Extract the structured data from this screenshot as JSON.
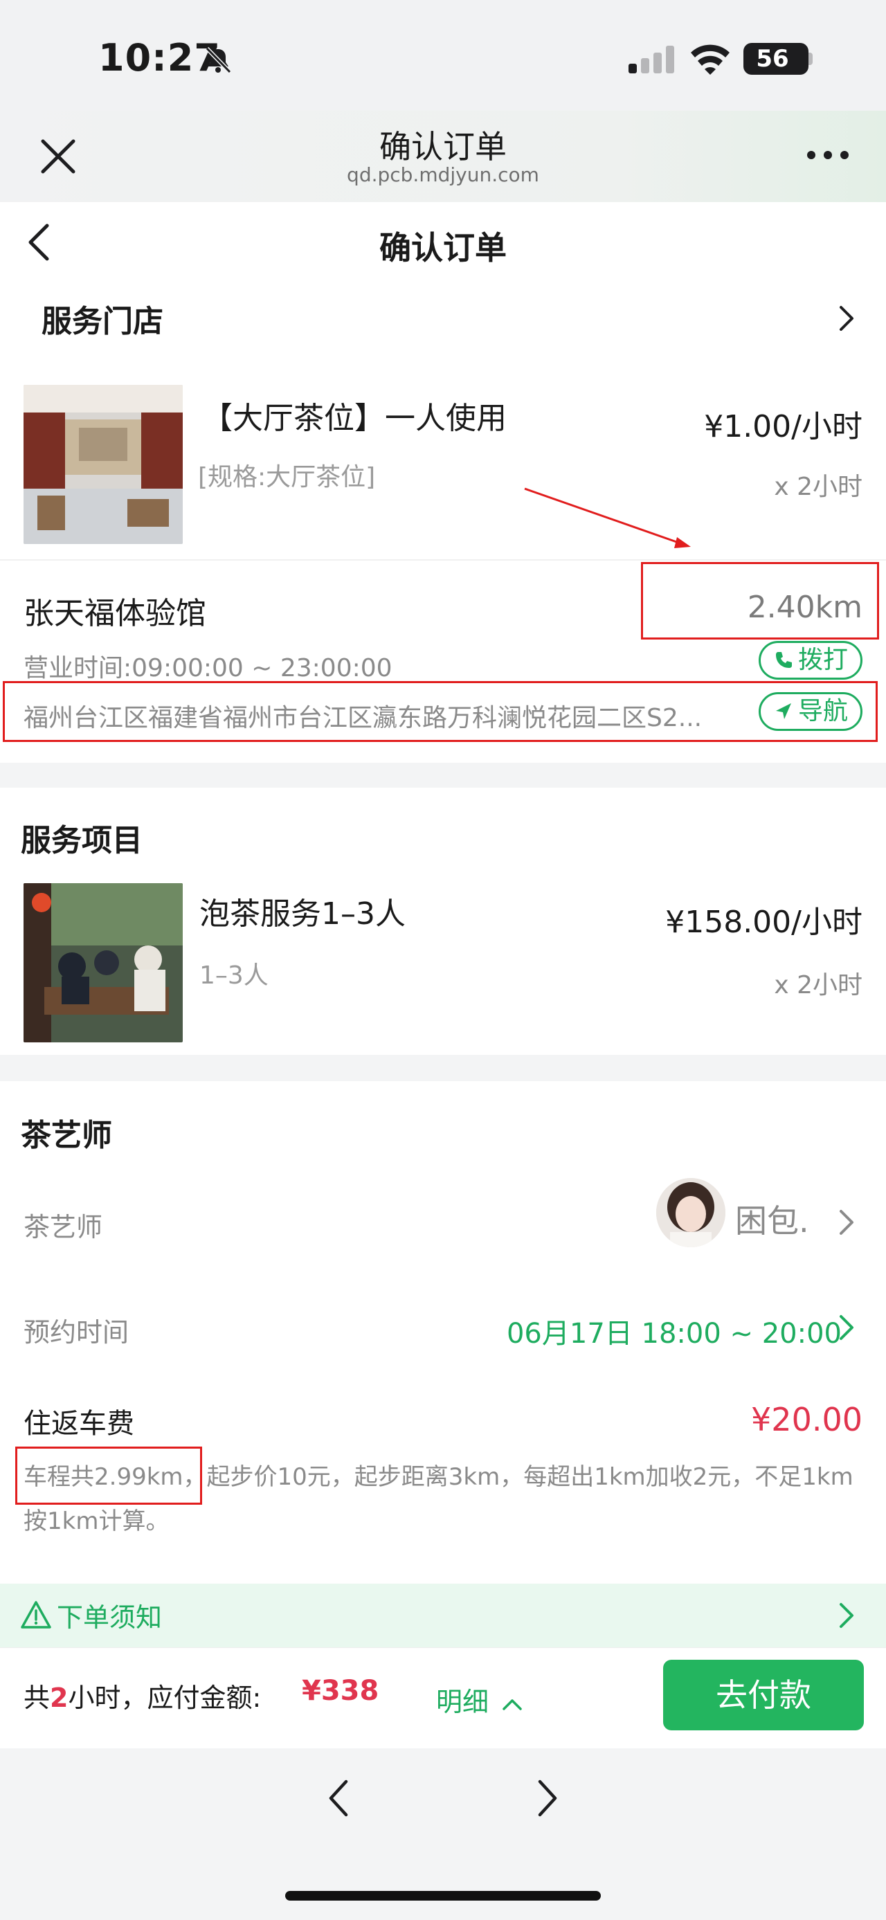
{
  "status_bar": {
    "time": "10:27",
    "battery": "56",
    "icons": [
      "bell-muted-icon",
      "signal-icon",
      "wifi-icon",
      "battery-icon"
    ]
  },
  "browser": {
    "title": "确认订单",
    "url": "qd.pcb.mdjyun.com",
    "icons": [
      "close-icon",
      "more-icon"
    ]
  },
  "header": {
    "title": "确认订单"
  },
  "store_section": {
    "title": "服务门店",
    "product": {
      "name": "【大厅茶位】一人使用",
      "spec": "[规格:大厅茶位]",
      "price": "¥1.00/小时",
      "qty": "x 2小时"
    },
    "store": {
      "name": "张天福体验馆",
      "distance": "2.40km",
      "hours": "营业时间:09:00:00 ~ 23:00:00",
      "address": "福州台江区福建省福州市台江区瀛东路万科澜悦花园二区S2...",
      "call_label": "拨打",
      "nav_label": "导航"
    }
  },
  "service_section": {
    "title": "服务项目",
    "item": {
      "name": "泡茶服务1–3人",
      "spec": "1–3人",
      "price": "¥158.00/小时",
      "qty": "x 2小时"
    }
  },
  "tea_master_section": {
    "title": "茶艺师",
    "master_label": "茶艺师",
    "master_name": "困包.",
    "appointment_label": "预约时间",
    "appointment_value": "06月17日 18:00 ~ 20:00",
    "fare_label": "住返车费",
    "fare_amount": "¥20.00",
    "fare_desc_highlight": "车程共2.99km，",
    "fare_desc_rest": "起步价10元，起步距离3km，每超出1km加收2元，不足1km按1km计算。"
  },
  "notice": {
    "label": "下单须知"
  },
  "footer": {
    "total_prefix": "共",
    "hours": "2",
    "total_suffix": "小时，应付金额:",
    "amount": "¥338",
    "detail_label": "明细",
    "pay_label": "去付款"
  },
  "colors": {
    "accent_green": "#1eac5f",
    "price_red": "#e0354e",
    "annotation_red": "#e11d1d"
  }
}
